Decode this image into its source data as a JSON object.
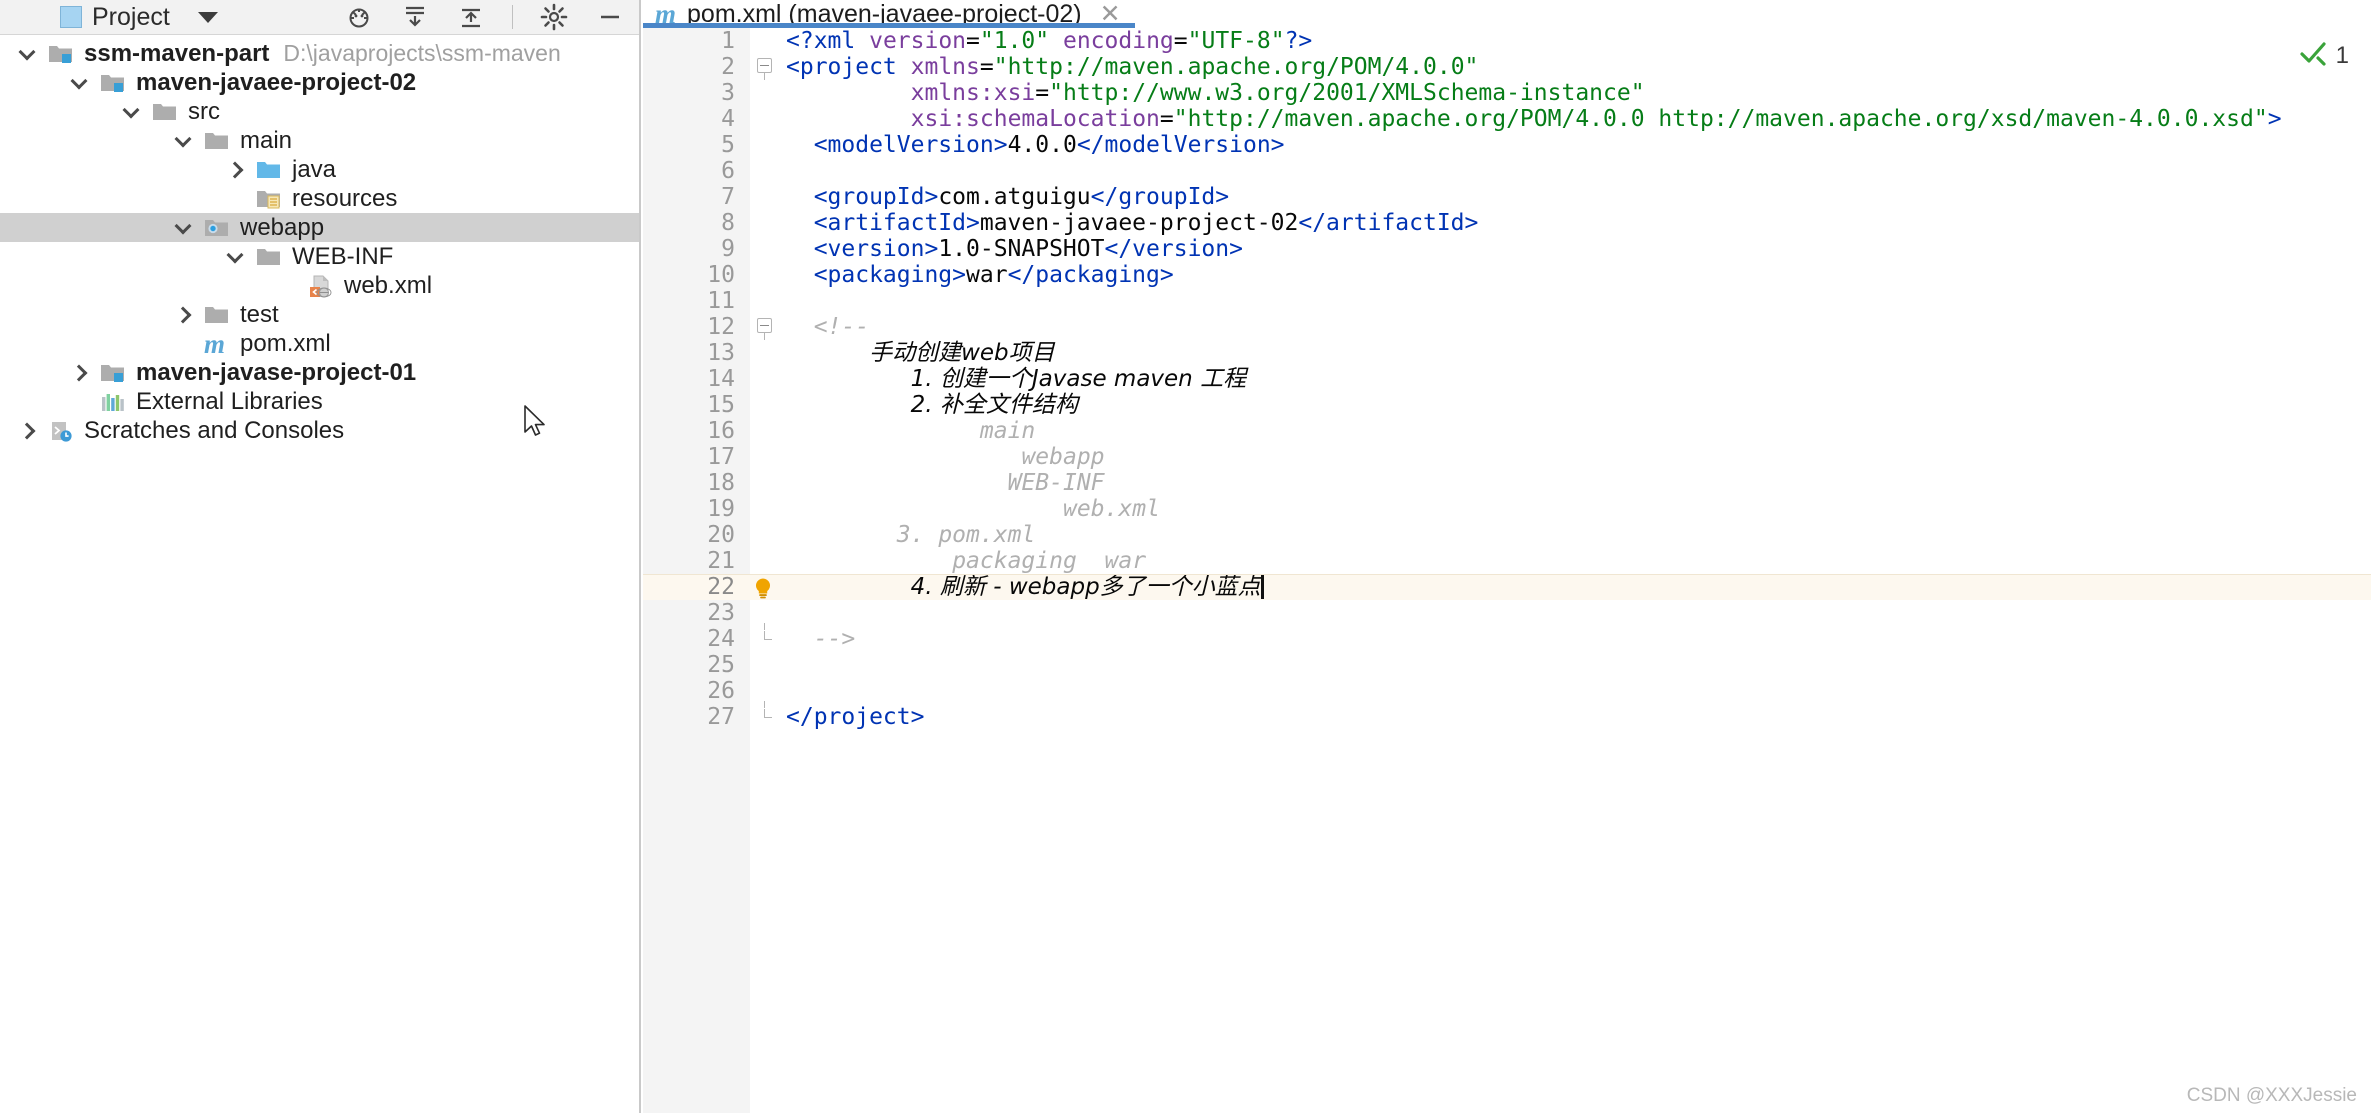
{
  "sidebar": {
    "toolbar": {
      "title": "Project",
      "dropdown_icon": "chevron-down-icon",
      "icons": [
        "bug-locate-icon",
        "collapse-down-icon",
        "expand-up-icon",
        "settings-gear-icon",
        "minimize-icon"
      ]
    },
    "tree": [
      {
        "label": "ssm-maven-part",
        "path": "D:\\javaprojects\\ssm-maven",
        "indent": 0,
        "arrow": "down",
        "icon": "module-folder-icon",
        "bold": true,
        "selected": false
      },
      {
        "label": "maven-javaee-project-02",
        "path": "",
        "indent": 1,
        "arrow": "down",
        "icon": "module-folder-icon",
        "bold": true,
        "selected": false
      },
      {
        "label": "src",
        "path": "",
        "indent": 2,
        "arrow": "down",
        "icon": "folder-icon",
        "bold": false,
        "selected": false
      },
      {
        "label": "main",
        "path": "",
        "indent": 3,
        "arrow": "down",
        "icon": "folder-icon",
        "bold": false,
        "selected": false
      },
      {
        "label": "java",
        "path": "",
        "indent": 4,
        "arrow": "right",
        "icon": "source-folder-icon",
        "bold": false,
        "selected": false
      },
      {
        "label": "resources",
        "path": "",
        "indent": 4,
        "arrow": "none",
        "icon": "resources-folder-icon",
        "bold": false,
        "selected": false
      },
      {
        "label": "webapp",
        "path": "",
        "indent": 3,
        "arrow": "down",
        "icon": "webapp-folder-icon",
        "bold": false,
        "selected": true
      },
      {
        "label": "WEB-INF",
        "path": "",
        "indent": 4,
        "arrow": "down",
        "icon": "folder-icon",
        "bold": false,
        "selected": false
      },
      {
        "label": "web.xml",
        "path": "",
        "indent": 5,
        "arrow": "none",
        "icon": "web-xml-file-icon",
        "bold": false,
        "selected": false
      },
      {
        "label": "test",
        "path": "",
        "indent": 3,
        "arrow": "right",
        "icon": "folder-icon",
        "bold": false,
        "selected": false
      },
      {
        "label": "pom.xml",
        "path": "",
        "indent": 3,
        "arrow": "none",
        "icon": "maven-pom-icon",
        "bold": false,
        "selected": false
      },
      {
        "label": "maven-javase-project-01",
        "path": "",
        "indent": 1,
        "arrow": "right",
        "icon": "module-folder-icon",
        "bold": true,
        "selected": false
      },
      {
        "label": "External Libraries",
        "path": "",
        "indent": 1,
        "arrow": "none",
        "icon": "external-libraries-icon",
        "bold": false,
        "selected": false
      },
      {
        "label": "Scratches and Consoles",
        "path": "",
        "indent": 0,
        "arrow": "right",
        "icon": "scratches-icon",
        "bold": false,
        "selected": false
      }
    ]
  },
  "editor": {
    "tab": {
      "file_icon": "maven-pom-icon",
      "label": "pom.xml (maven-javaee-project-02)",
      "close_icon": "close-icon"
    },
    "inspection": {
      "icon": "inspection-ok-icon",
      "count": "1",
      "color": "#3aa33a"
    },
    "cursor_line": 22,
    "highlighted_line": 22,
    "lines": [
      {
        "n": 1,
        "indent": 0,
        "fold": "none",
        "bulb": false,
        "parts": [
          {
            "t": "<?xml ",
            "c": "pi"
          },
          {
            "t": "version",
            "c": "attr"
          },
          {
            "t": "=",
            "c": "txtv"
          },
          {
            "t": "\"1.0\"",
            "c": "str"
          },
          {
            "t": " encoding",
            "c": "attr"
          },
          {
            "t": "=",
            "c": "txtv"
          },
          {
            "t": "\"UTF-8\"",
            "c": "str"
          },
          {
            "t": "?>",
            "c": "pi"
          }
        ]
      },
      {
        "n": 2,
        "indent": 0,
        "fold": "open",
        "bulb": false,
        "parts": [
          {
            "t": "<project ",
            "c": "tag"
          },
          {
            "t": "xmlns",
            "c": "attr"
          },
          {
            "t": "=",
            "c": "txtv"
          },
          {
            "t": "\"http://maven.apache.org/POM/4.0.0\"",
            "c": "str"
          }
        ]
      },
      {
        "n": 3,
        "indent": 9,
        "fold": "none",
        "bulb": false,
        "parts": [
          {
            "t": "xmlns:xsi",
            "c": "attr"
          },
          {
            "t": "=",
            "c": "txtv"
          },
          {
            "t": "\"http://www.w3.org/2001/XMLSchema-instance\"",
            "c": "str"
          }
        ]
      },
      {
        "n": 4,
        "indent": 9,
        "fold": "none",
        "bulb": false,
        "parts": [
          {
            "t": "xsi:schemaLocation",
            "c": "attr"
          },
          {
            "t": "=",
            "c": "txtv"
          },
          {
            "t": "\"http://maven.apache.org/POM/4.0.0 http://maven.apache.org/xsd/maven-4.0.0.xsd\"",
            "c": "str"
          },
          {
            "t": ">",
            "c": "tag"
          }
        ]
      },
      {
        "n": 5,
        "indent": 2,
        "fold": "none",
        "bulb": false,
        "parts": [
          {
            "t": "<modelVersion>",
            "c": "tag"
          },
          {
            "t": "4.0.0",
            "c": "txtv"
          },
          {
            "t": "</modelVersion>",
            "c": "tag"
          }
        ]
      },
      {
        "n": 6,
        "indent": 0,
        "fold": "none",
        "bulb": false,
        "parts": []
      },
      {
        "n": 7,
        "indent": 2,
        "fold": "none",
        "bulb": false,
        "parts": [
          {
            "t": "<groupId>",
            "c": "tag"
          },
          {
            "t": "com.atguigu",
            "c": "txtv"
          },
          {
            "t": "</groupId>",
            "c": "tag"
          }
        ]
      },
      {
        "n": 8,
        "indent": 2,
        "fold": "none",
        "bulb": false,
        "parts": [
          {
            "t": "<artifactId>",
            "c": "tag"
          },
          {
            "t": "maven-javaee-project-02",
            "c": "txtv"
          },
          {
            "t": "</artifactId>",
            "c": "tag"
          }
        ]
      },
      {
        "n": 9,
        "indent": 2,
        "fold": "none",
        "bulb": false,
        "parts": [
          {
            "t": "<version>",
            "c": "tag"
          },
          {
            "t": "1.0-SNAPSHOT",
            "c": "txtv"
          },
          {
            "t": "</version>",
            "c": "tag"
          }
        ]
      },
      {
        "n": 10,
        "indent": 2,
        "fold": "none",
        "bulb": false,
        "parts": [
          {
            "t": "<packaging>",
            "c": "tag"
          },
          {
            "t": "war",
            "c": "txtv"
          },
          {
            "t": "</packaging>",
            "c": "tag"
          }
        ]
      },
      {
        "n": 11,
        "indent": 0,
        "fold": "none",
        "bulb": false,
        "parts": []
      },
      {
        "n": 12,
        "indent": 2,
        "fold": "open",
        "bulb": false,
        "parts": [
          {
            "t": "<!--",
            "c": "cmt"
          }
        ]
      },
      {
        "n": 13,
        "indent": 6,
        "fold": "none",
        "bulb": false,
        "parts": [
          {
            "t": "手动创建web项目",
            "c": "cmt-cn"
          }
        ]
      },
      {
        "n": 14,
        "indent": 9,
        "fold": "none",
        "bulb": false,
        "parts": [
          {
            "t": "1. 创建一个Javase maven 工程",
            "c": "cmt-cn"
          }
        ]
      },
      {
        "n": 15,
        "indent": 9,
        "fold": "none",
        "bulb": false,
        "parts": [
          {
            "t": "2. 补全文件结构",
            "c": "cmt-cn"
          }
        ]
      },
      {
        "n": 16,
        "indent": 14,
        "fold": "none",
        "bulb": false,
        "parts": [
          {
            "t": "main",
            "c": "cmt"
          }
        ]
      },
      {
        "n": 17,
        "indent": 17,
        "fold": "none",
        "bulb": false,
        "parts": [
          {
            "t": "webapp",
            "c": "cmt"
          }
        ]
      },
      {
        "n": 18,
        "indent": 16,
        "fold": "none",
        "bulb": false,
        "parts": [
          {
            "t": "WEB-INF",
            "c": "cmt"
          }
        ]
      },
      {
        "n": 19,
        "indent": 20,
        "fold": "none",
        "bulb": false,
        "parts": [
          {
            "t": "web.xml",
            "c": "cmt"
          }
        ]
      },
      {
        "n": 20,
        "indent": 8,
        "fold": "none",
        "bulb": false,
        "parts": [
          {
            "t": "3. pom.xml",
            "c": "cmt"
          }
        ]
      },
      {
        "n": 21,
        "indent": 12,
        "fold": "none",
        "bulb": false,
        "parts": [
          {
            "t": "packaging  war",
            "c": "cmt"
          }
        ]
      },
      {
        "n": 22,
        "indent": 9,
        "fold": "none",
        "bulb": true,
        "parts": [
          {
            "t": "4. 刷新 - webapp多了一个小蓝点",
            "c": "cmt-cn"
          }
        ]
      },
      {
        "n": 23,
        "indent": 0,
        "fold": "none",
        "bulb": false,
        "parts": []
      },
      {
        "n": 24,
        "indent": 2,
        "fold": "close",
        "bulb": false,
        "parts": [
          {
            "t": "-->",
            "c": "cmt"
          }
        ]
      },
      {
        "n": 25,
        "indent": 0,
        "fold": "none",
        "bulb": false,
        "parts": []
      },
      {
        "n": 26,
        "indent": 0,
        "fold": "none",
        "bulb": false,
        "parts": []
      },
      {
        "n": 27,
        "indent": 0,
        "fold": "close",
        "bulb": false,
        "parts": [
          {
            "t": "</project>",
            "c": "tag"
          }
        ]
      }
    ]
  },
  "watermark": "CSDN @XXXJessie",
  "colors": {
    "tag": "#0033b3",
    "attr": "#7a3e9d",
    "string": "#067d17",
    "comment": "#b0b0b0",
    "selection": "#d0d0d0",
    "tab_underline": "#4a86c8",
    "highlight_line": "#fdf8ef"
  }
}
